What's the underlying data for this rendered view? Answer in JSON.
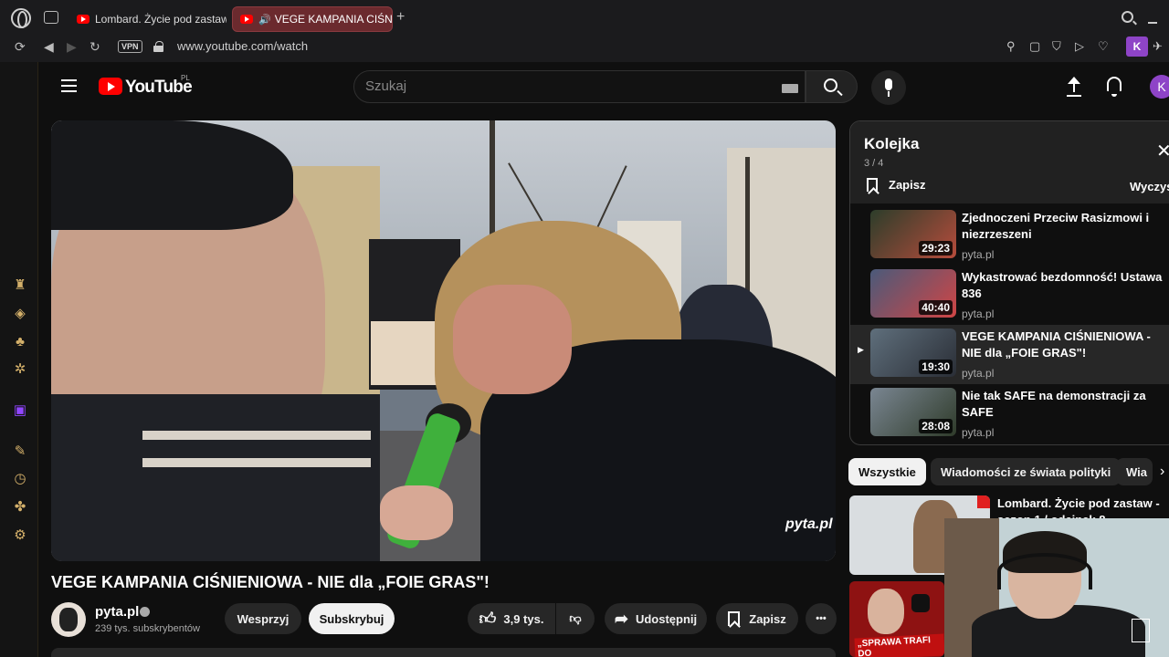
{
  "browser": {
    "tabs": [
      {
        "title": "Lombard. Życie pod zastaw",
        "active": false
      },
      {
        "title": "VEGE KAMPANIA CIŚNIE",
        "active": true,
        "audio": "🔊"
      }
    ],
    "new_tab_label": "+",
    "vpn_label": "VPN",
    "url": "www.youtube.com/watch",
    "profile_initial": "K"
  },
  "youtube": {
    "logo_text": "YouTube",
    "region": "PL",
    "search_placeholder": "Szukaj",
    "avatar_initial": "K"
  },
  "video": {
    "title": "VEGE KAMPANIA CIŚNIENIOWA - NIE dla „FOIE GRAS\"!",
    "watermark": "pyta.pl",
    "channel": {
      "name": "pyta.pl",
      "subscribers": "239 tys. subskrybentów"
    },
    "actions": {
      "support": "Wesprzyj",
      "subscribe": "Subskrybuj",
      "likes": "3,9 tys.",
      "share": "Udostępnij",
      "save": "Zapisz",
      "more": "•••"
    }
  },
  "queue": {
    "title": "Kolejka",
    "position": "3 / 4",
    "save_label": "Zapisz",
    "clear_label": "Wyczyść",
    "items": [
      {
        "title": "Zjednoczeni Przeciw Rasizmowi i niezrzeszeni",
        "channel": "pyta.pl",
        "duration": "29:23",
        "current": false
      },
      {
        "title": "Wykastrować bezdomność! Ustawa 836",
        "channel": "pyta.pl",
        "duration": "40:40",
        "current": false
      },
      {
        "title": "VEGE KAMPANIA CIŚNIENIOWA - NIE dla „FOIE GRAS\"!",
        "channel": "pyta.pl",
        "duration": "19:30",
        "current": true
      },
      {
        "title": "Nie tak SAFE na demonstracji za SAFE",
        "channel": "pyta.pl",
        "duration": "28:08",
        "current": false
      }
    ]
  },
  "chips": [
    "Wszystkie",
    "Wiadomości ze świata polityki",
    "Wia"
  ],
  "recommendations": [
    {
      "title": "Lombard. Życie pod zastaw -",
      "title_line2": "sezon 1 / odcinek 8"
    },
    {
      "caption": "„SPRAWA TRAFI DO"
    }
  ],
  "colors": {
    "accent": "#ff0000",
    "active_tab": "#6b2a2e",
    "sidebar_icons": "#d4b06a"
  }
}
